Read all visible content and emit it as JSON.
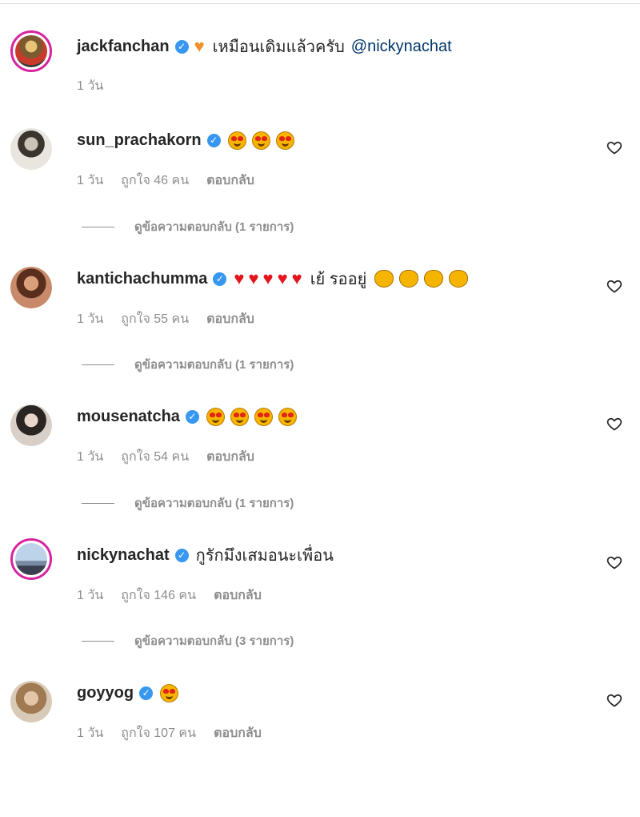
{
  "caption": {
    "username": "jackfanchan",
    "verified_icon": "verified-badge-icon",
    "text": "เหมือนเดิมแล้วครับ",
    "mention": "@nickynachat",
    "time": "1 วัน",
    "emoji": "orange-heart"
  },
  "comments": [
    {
      "username": "sun_prachakorn",
      "text": "",
      "emojis": [
        "heart-eyes",
        "heart-eyes",
        "heart-eyes"
      ],
      "time": "1 วัน",
      "likes": "ถูกใจ 46 คน",
      "reply": "ตอบกลับ",
      "view_replies": "ดูข้อความตอบกลับ (1 รายการ)"
    },
    {
      "username": "kantichachumma",
      "text": "เย้ รออยู่",
      "emojis_before": [
        "red-heart",
        "red-heart",
        "red-heart",
        "red-heart",
        "red-heart"
      ],
      "emojis_after": [
        "clapping-hands",
        "clapping-hands",
        "clapping-hands",
        "clapping-hands"
      ],
      "time": "1 วัน",
      "likes": "ถูกใจ 55 คน",
      "reply": "ตอบกลับ",
      "view_replies": "ดูข้อความตอบกลับ (1 รายการ)"
    },
    {
      "username": "mousenatcha",
      "text": "",
      "emojis": [
        "heart-eyes",
        "heart-eyes",
        "heart-eyes",
        "heart-eyes"
      ],
      "time": "1 วัน",
      "likes": "ถูกใจ 54 คน",
      "reply": "ตอบกลับ",
      "view_replies": "ดูข้อความตอบกลับ (1 รายการ)"
    },
    {
      "username": "nickynachat",
      "text": "กูรักมึงเสมอนะเพื่อน",
      "time": "1 วัน",
      "likes": "ถูกใจ 146 คน",
      "reply": "ตอบกลับ",
      "view_replies": "ดูข้อความตอบกลับ (3 รายการ)"
    },
    {
      "username": "goyyog",
      "text": "",
      "emojis": [
        "heart-eyes"
      ],
      "time": "1 วัน",
      "likes": "ถูกใจ 107 คน",
      "reply": "ตอบกลับ"
    }
  ],
  "icons": {
    "like": "heart-outline-icon",
    "verified": "verified-badge-icon"
  },
  "colors": {
    "verified_blue": "#3897f0",
    "story_ring": "#d6249f",
    "mention": "#00376b",
    "muted": "#8e8e8e"
  }
}
